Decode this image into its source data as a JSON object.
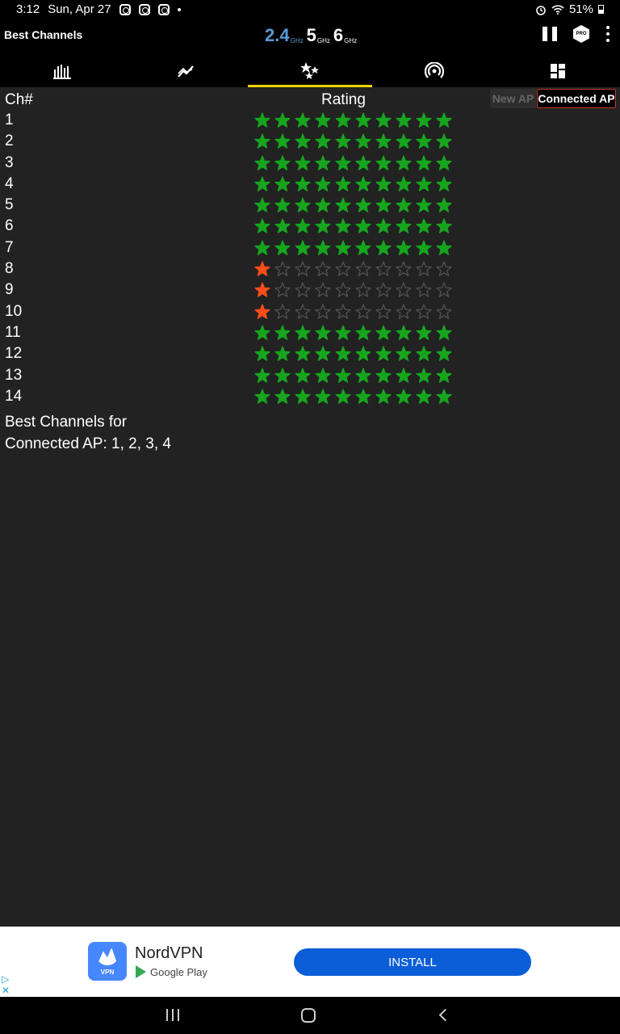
{
  "status_bar": {
    "time": "3:12",
    "date": "Sun, Apr 27",
    "battery": "51%",
    "notification_icons": [
      "instagram-icon",
      "instagram-icon",
      "instagram-icon"
    ]
  },
  "app_bar": {
    "title": "Best Channels",
    "bands": [
      {
        "num": "2.4",
        "unit": "GHz",
        "active": true
      },
      {
        "num": "5",
        "unit": "GHz",
        "active": false
      },
      {
        "num": "6",
        "unit": "GHz",
        "active": false
      }
    ],
    "pro_badge": "PRO"
  },
  "tabs": [
    {
      "icon": "bar-graph-icon",
      "active": false
    },
    {
      "icon": "time-graph-icon",
      "active": false
    },
    {
      "icon": "stars-rating-icon",
      "active": true
    },
    {
      "icon": "access-points-icon",
      "active": false
    },
    {
      "icon": "dashboard-icon",
      "active": false
    }
  ],
  "table": {
    "col_channel": "Ch#",
    "col_rating": "Rating",
    "toggle_new": "New AP",
    "toggle_connected": "Connected AP",
    "max_stars": 10,
    "rows": [
      {
        "channel": "1",
        "stars": 10
      },
      {
        "channel": "2",
        "stars": 10
      },
      {
        "channel": "3",
        "stars": 10
      },
      {
        "channel": "4",
        "stars": 10
      },
      {
        "channel": "5",
        "stars": 10
      },
      {
        "channel": "6",
        "stars": 10
      },
      {
        "channel": "7",
        "stars": 10
      },
      {
        "channel": "8",
        "stars": 1
      },
      {
        "channel": "9",
        "stars": 1
      },
      {
        "channel": "10",
        "stars": 1
      },
      {
        "channel": "11",
        "stars": 10
      },
      {
        "channel": "12",
        "stars": 10
      },
      {
        "channel": "13",
        "stars": 10
      },
      {
        "channel": "14",
        "stars": 10
      }
    ]
  },
  "best_line1": "Best Channels for",
  "best_line2": "Connected AP: 1, 2, 3, 4",
  "colors": {
    "star_good": "#17a51e",
    "star_bad": "#ff4d1a",
    "star_empty": "#555555",
    "accent": "#f2d000",
    "band_active": "#5b9bd5"
  },
  "ad": {
    "app_name": "NordVPN",
    "logo_text": "VPN",
    "store": "Google Play",
    "install_label": "INSTALL"
  }
}
